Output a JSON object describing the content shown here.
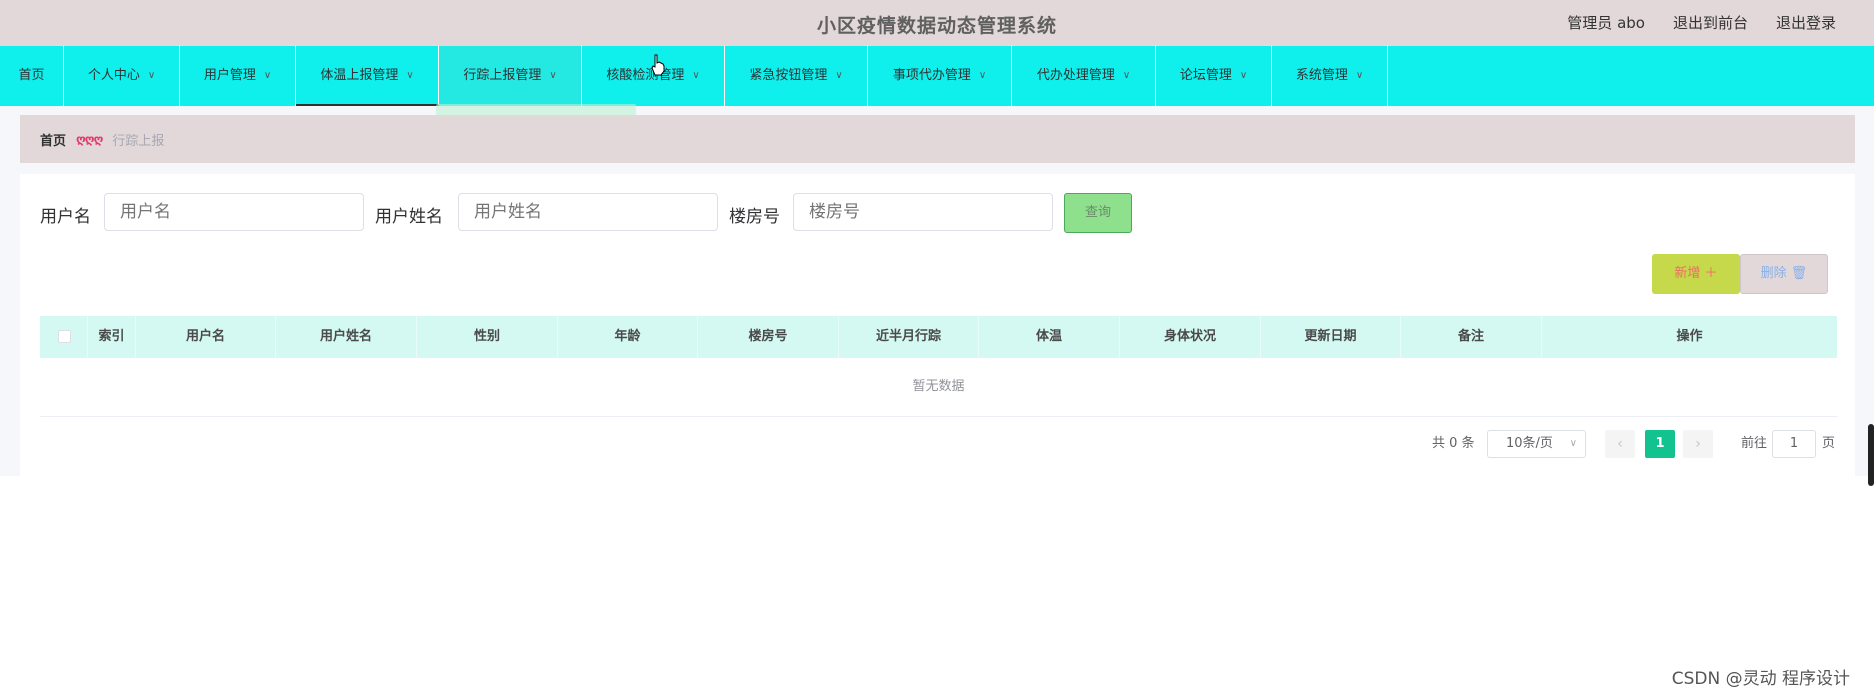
{
  "header": {
    "title": "小区疫情数据动态管理系统",
    "links": [
      "管理员 abo",
      "退出到前台",
      "退出登录"
    ]
  },
  "nav": {
    "items": [
      {
        "label": "首页",
        "has_dropdown": false
      },
      {
        "label": "个人中心",
        "has_dropdown": true
      },
      {
        "label": "用户管理",
        "has_dropdown": true
      },
      {
        "label": "体温上报管理",
        "has_dropdown": true
      },
      {
        "label": "行踪上报管理",
        "has_dropdown": true
      },
      {
        "label": "核酸检测管理",
        "has_dropdown": true
      },
      {
        "label": "紧急按钮管理",
        "has_dropdown": true
      },
      {
        "label": "事项代办管理",
        "has_dropdown": true
      },
      {
        "label": "代办处理管理",
        "has_dropdown": true
      },
      {
        "label": "论坛管理",
        "has_dropdown": true
      },
      {
        "label": "系统管理",
        "has_dropdown": true
      }
    ],
    "active_index": 3,
    "hover_index": 4
  },
  "breadcrumb": {
    "home": "首页",
    "separator": "ღღღ",
    "current": "行踪上报"
  },
  "search": {
    "fields": [
      {
        "label": "用户名",
        "placeholder": "用户名",
        "value": ""
      },
      {
        "label": "用户姓名",
        "placeholder": "用户姓名",
        "value": ""
      },
      {
        "label": "楼房号",
        "placeholder": "楼房号",
        "value": ""
      }
    ],
    "query_label": "查询"
  },
  "actions": {
    "add_label": "新增 ＋",
    "delete_label": "删除 🗑"
  },
  "table": {
    "columns": [
      "索引",
      "用户名",
      "用户姓名",
      "性别",
      "年龄",
      "楼房号",
      "近半月行踪",
      "体温",
      "身体状况",
      "更新日期",
      "备注",
      "操作"
    ],
    "rows": [],
    "empty_text": "暂无数据"
  },
  "pagination": {
    "total_text": "共 0 条",
    "page_size": "10条/页",
    "current_page": "1",
    "goto_prefix": "前往",
    "goto_value": "1",
    "goto_suffix": "页"
  },
  "watermark": "CSDN @灵动 程序设计",
  "colors": {
    "topbar": "#e2d8d9",
    "navbar": "#0ff0ec",
    "table_header": "#d4f8f2",
    "query_button": "#8fe08d",
    "add_button": "#c5d94a",
    "page_active": "#13c38f"
  }
}
